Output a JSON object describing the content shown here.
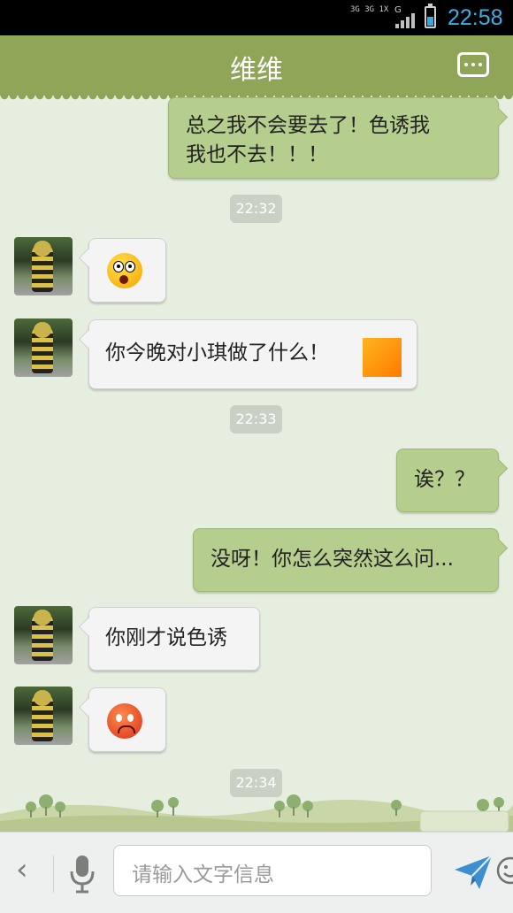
{
  "status_bar": {
    "network_top": "3G 3G 1X",
    "network_indicator": "G",
    "battery_level": 0.55,
    "time": "22:58"
  },
  "header": {
    "title": "维维",
    "more_icon": "more-dots-icon"
  },
  "messages": [
    {
      "type": "text",
      "side": "out",
      "text": "总之我不会要去了！色诱我\n我也不去！！！"
    },
    {
      "type": "timestamp",
      "text": "22:32"
    },
    {
      "type": "emoji",
      "side": "in",
      "icon": "surprised-emoji-icon"
    },
    {
      "type": "text",
      "side": "in",
      "text": "你今晚对小琪做了什么！",
      "sticker": "orange-square-icon"
    },
    {
      "type": "timestamp",
      "text": "22:33"
    },
    {
      "type": "text",
      "side": "out",
      "text": "诶？？"
    },
    {
      "type": "text",
      "side": "out",
      "text": "没呀！你怎么突然这么问..."
    },
    {
      "type": "text",
      "side": "in",
      "text": "你刚才说色诱"
    },
    {
      "type": "emoji",
      "side": "in",
      "icon": "sad-emoji-icon"
    },
    {
      "type": "timestamp",
      "text": "22:34"
    }
  ],
  "input_bar": {
    "placeholder": "请输入文字信息",
    "back_icon": "chevron-left-icon",
    "mic_icon": "microphone-icon",
    "emoji_icon": "smiley-icon",
    "send_icon": "send-icon"
  },
  "colors": {
    "header": "#8fa558",
    "outgoing_bubble": "#b5cd8d",
    "incoming_bubble": "#f4f4f4",
    "background": "#e6efdf",
    "time_accent": "#3aaee6"
  }
}
